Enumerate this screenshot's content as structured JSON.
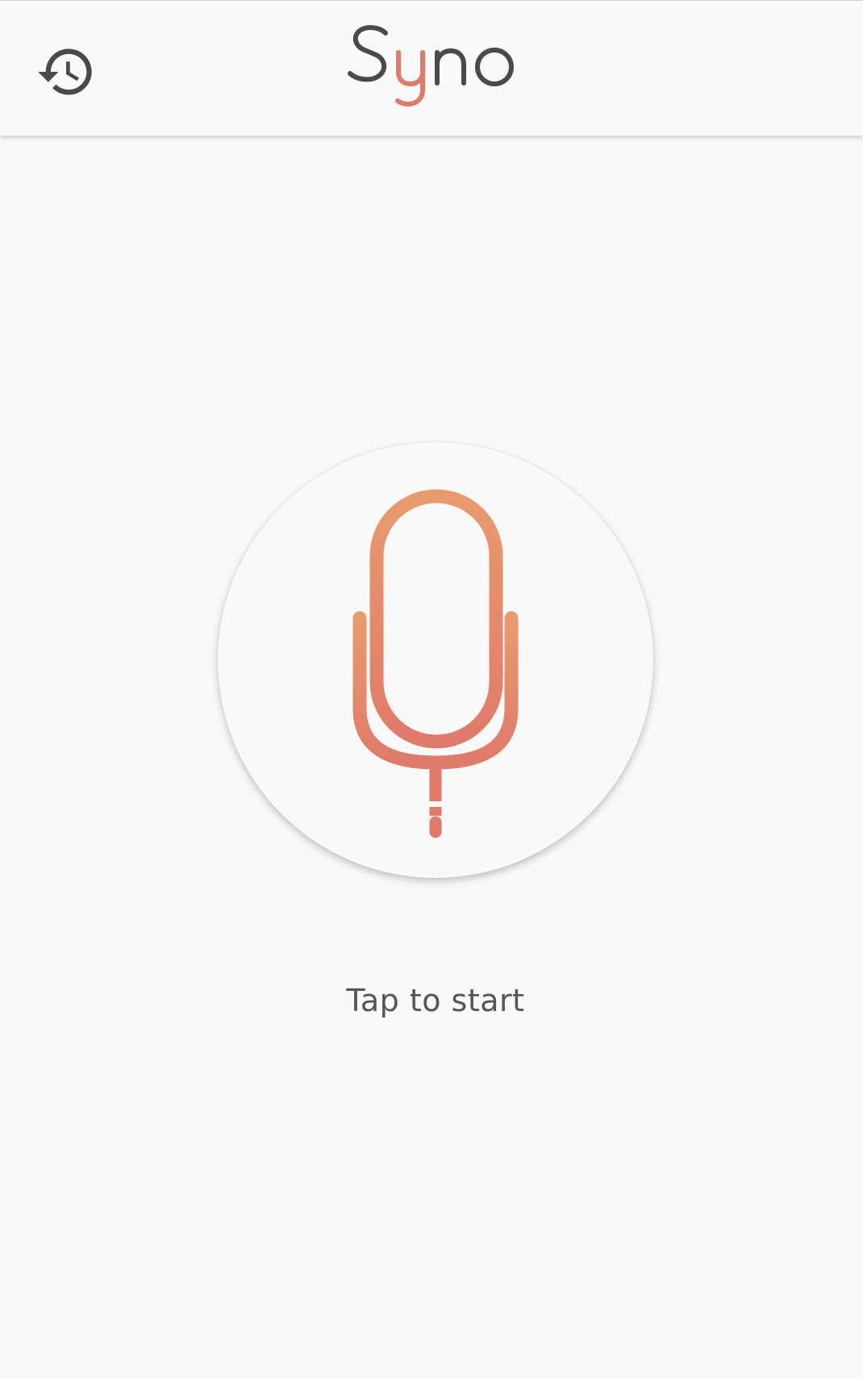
{
  "header": {
    "history_icon": "history-icon",
    "logo_text": "Syno",
    "logo_colors": {
      "main": "#4a4a4a",
      "accent": "#e07a6b"
    }
  },
  "main": {
    "mic_icon": "microphone-icon",
    "mic_gradient": {
      "top": "#e89b6e",
      "bottom": "#e07a6b"
    },
    "prompt_text": "Tap to start"
  }
}
